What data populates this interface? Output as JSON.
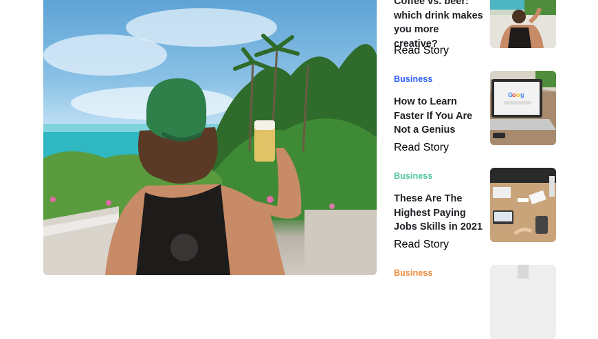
{
  "stories": [
    {
      "category": "",
      "category_color": "#000000",
      "title": "Coffee vs. beer: which drink makes you more creative?",
      "read_label": "Read Story",
      "thumb_icon": "man-on-beach-thumbnail"
    },
    {
      "category": "Business",
      "category_color": "#2b5cff",
      "title": "How to Learn Faster If You Are Not a Genius",
      "read_label": "Read Story",
      "thumb_icon": "laptop-google-thumbnail"
    },
    {
      "category": "Business",
      "category_color": "#4cc79a",
      "title": "These Are The Highest Paying Jobs Skills in 2021",
      "read_label": "Read Story",
      "thumb_icon": "office-desk-thumbnail"
    },
    {
      "category": "Business",
      "category_color": "#f28a3a",
      "title": "",
      "read_label": "",
      "thumb_icon": "office-thumbnail-partial"
    }
  ],
  "hero": {
    "image_icon": "man-with-beer-on-tropical-beach-photo"
  }
}
